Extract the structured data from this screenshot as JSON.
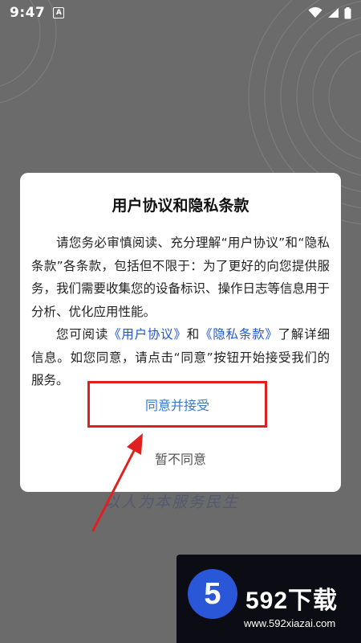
{
  "status_bar": {
    "time": "9:47",
    "notification_letter": "A"
  },
  "dialog": {
    "title": "用户协议和隐私条款",
    "para1": "请您务必审慎阅读、充分理解“用户协议”和“隐私条款”各条款，包括但不限于：为了更好的向您提供服务，我们需要收集您的设备标识、操作日志等信息用于分析、优化应用性能。",
    "para2_prefix": "您可阅读",
    "link_user_agreement": "《用户协议》",
    "para2_and": "和",
    "link_privacy": "《隐私条款》",
    "para2_suffix": "了解详细信息。如您同意，请点击“同意”按钮开始接受我们的服务。",
    "accept_label": "同意并接受",
    "decline_label": "暂不同意"
  },
  "background": {
    "slogan": "以人为本服务民生"
  },
  "watermark": {
    "number": "5",
    "title": "592下载",
    "url": "www.592xiazai.com"
  },
  "colors": {
    "background": "#6b6b6b",
    "link": "#2255cc",
    "accept_text": "#3a78c8",
    "annotation_red": "#e02020"
  }
}
